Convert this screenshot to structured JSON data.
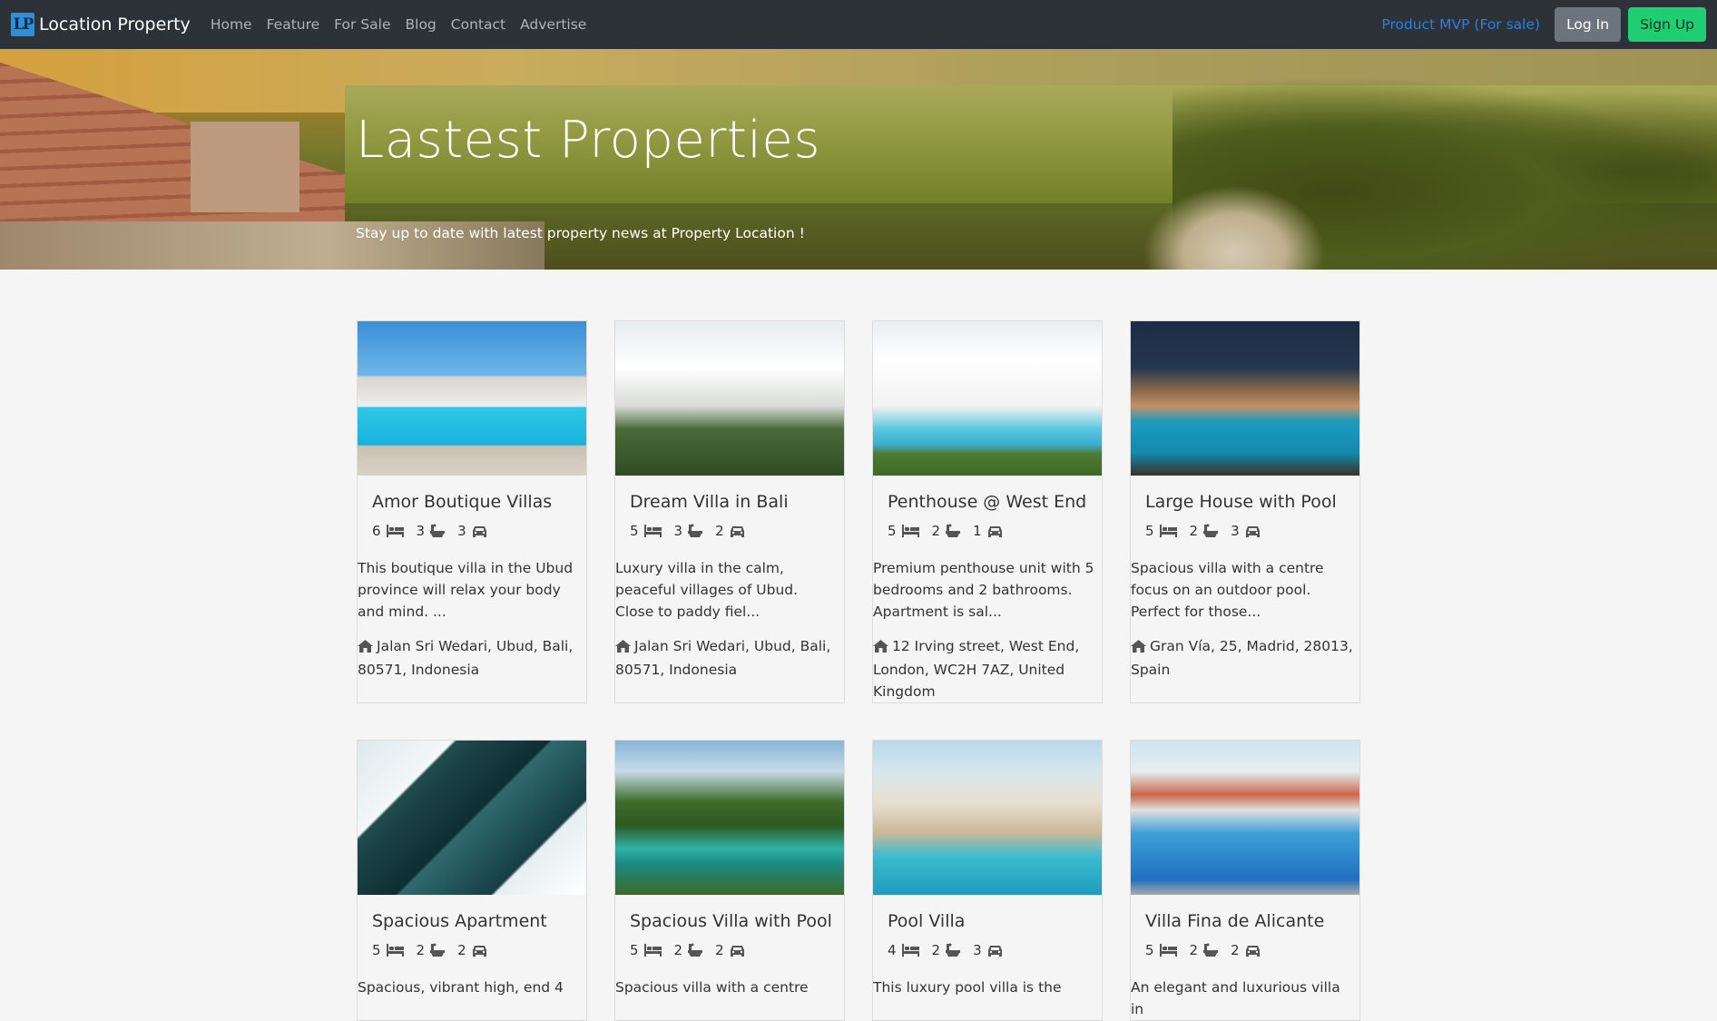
{
  "navbar": {
    "logo_text": "LP",
    "brand": "Location Property",
    "links": [
      "Home",
      "Feature",
      "For Sale",
      "Blog",
      "Contact",
      "Advertise"
    ],
    "mvp_link": "Product MVP (For sale)",
    "login": "Log In",
    "signup": "Sign Up"
  },
  "hero": {
    "title": "Lastest Properties",
    "subtitle": "Stay up to date with latest property news at Property Location !"
  },
  "properties": [
    {
      "title": "Amor Boutique Villas",
      "beds": "6",
      "baths": "3",
      "cars": "3",
      "description": "This boutique villa in the Ubud province will relax your body and mind. ...",
      "address": "Jalan Sri Wedari, Ubud, Bali, 80571, Indonesia"
    },
    {
      "title": "Dream Villa in Bali",
      "beds": "5",
      "baths": "3",
      "cars": "2",
      "description": "Luxury villa in the calm, peaceful villages of Ubud. Close to paddy fiel...",
      "address": "Jalan Sri Wedari, Ubud, Bali, 80571, Indonesia"
    },
    {
      "title": "Penthouse @ West End",
      "beds": "5",
      "baths": "2",
      "cars": "1",
      "description": "Premium penthouse unit with 5 bedrooms and 2 bathrooms. Apartment is sal...",
      "address": "12 Irving street, West End, London, WC2H 7AZ, United Kingdom"
    },
    {
      "title": "Large House with Pool",
      "beds": "5",
      "baths": "2",
      "cars": "3",
      "description": "Spacious villa with a centre focus on an outdoor pool. Perfect for those...",
      "address": "Gran Vía, 25, Madrid, 28013, Spain"
    },
    {
      "title": "Spacious Apartment",
      "beds": "5",
      "baths": "2",
      "cars": "2",
      "description": "Spacious, vibrant high, end 4",
      "address": ""
    },
    {
      "title": "Spacious Villa with Pool",
      "beds": "5",
      "baths": "2",
      "cars": "2",
      "description": "Spacious villa with a centre",
      "address": ""
    },
    {
      "title": "Pool Villa",
      "beds": "4",
      "baths": "2",
      "cars": "3",
      "description": "This luxury pool villa is the",
      "address": ""
    },
    {
      "title": "Villa Fina de Alicante",
      "beds": "5",
      "baths": "2",
      "cars": "2",
      "description": "An elegant and luxurious villa in",
      "address": ""
    }
  ],
  "colors": {
    "navbar_bg": "#2d3238",
    "link_accent": "#2b7fe0",
    "signup_bg": "#1fce73",
    "login_bg": "#6c757d"
  },
  "icons": [
    "bed-icon",
    "bath-icon",
    "car-icon",
    "home-icon"
  ]
}
